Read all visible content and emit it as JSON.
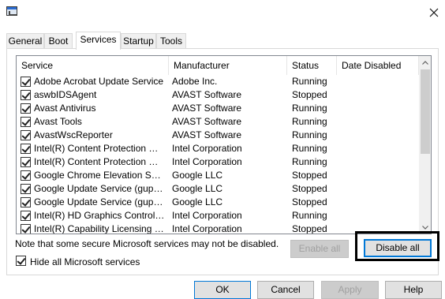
{
  "window": {
    "title": ""
  },
  "tabs": [
    {
      "label": "General"
    },
    {
      "label": "Boot"
    },
    {
      "label": "Services",
      "active": true
    },
    {
      "label": "Startup"
    },
    {
      "label": "Tools"
    }
  ],
  "list": {
    "columns": [
      "Service",
      "Manufacturer",
      "Status",
      "Date Disabled"
    ],
    "rows": [
      {
        "service": "Adobe Acrobat Update Service",
        "manufacturer": "Adobe Inc.",
        "status": "Running",
        "date": "",
        "checked": true
      },
      {
        "service": "aswbIDSAgent",
        "manufacturer": "AVAST Software",
        "status": "Stopped",
        "date": "",
        "checked": true
      },
      {
        "service": "Avast Antivirus",
        "manufacturer": "AVAST Software",
        "status": "Running",
        "date": "",
        "checked": true
      },
      {
        "service": "Avast Tools",
        "manufacturer": "AVAST Software",
        "status": "Running",
        "date": "",
        "checked": true
      },
      {
        "service": "AvastWscReporter",
        "manufacturer": "AVAST Software",
        "status": "Running",
        "date": "",
        "checked": true
      },
      {
        "service": "Intel(R) Content Protection HEC...",
        "manufacturer": "Intel Corporation",
        "status": "Running",
        "date": "",
        "checked": true
      },
      {
        "service": "Intel(R) Content Protection HDC...",
        "manufacturer": "Intel Corporation",
        "status": "Running",
        "date": "",
        "checked": true
      },
      {
        "service": "Google Chrome Elevation Service",
        "manufacturer": "Google LLC",
        "status": "Stopped",
        "date": "",
        "checked": true
      },
      {
        "service": "Google Update Service (gupdate)",
        "manufacturer": "Google LLC",
        "status": "Stopped",
        "date": "",
        "checked": true
      },
      {
        "service": "Google Update Service (gupdatem)",
        "manufacturer": "Google LLC",
        "status": "Stopped",
        "date": "",
        "checked": true
      },
      {
        "service": "Intel(R) HD Graphics Control Pa...",
        "manufacturer": "Intel Corporation",
        "status": "Running",
        "date": "",
        "checked": true
      },
      {
        "service": "Intel(R) Capability Licensing Ser...",
        "manufacturer": "Intel Corporation",
        "status": "Stopped",
        "date": "",
        "checked": true
      }
    ]
  },
  "note": "Note that some secure Microsoft services may not be disabled.",
  "buttons": {
    "enable_all": "Enable all",
    "disable_all": "Disable all",
    "ok": "OK",
    "cancel": "Cancel",
    "apply": "Apply",
    "help": "Help"
  },
  "hide_ms": {
    "label": "Hide all Microsoft services",
    "checked": true
  },
  "icons": {
    "app": "system-config-icon",
    "close": "close-icon",
    "scroll_up": "chevron-up-icon",
    "scroll_down": "chevron-down-icon"
  },
  "colors": {
    "accent": "#0078d7",
    "highlight_box": "#000000"
  }
}
